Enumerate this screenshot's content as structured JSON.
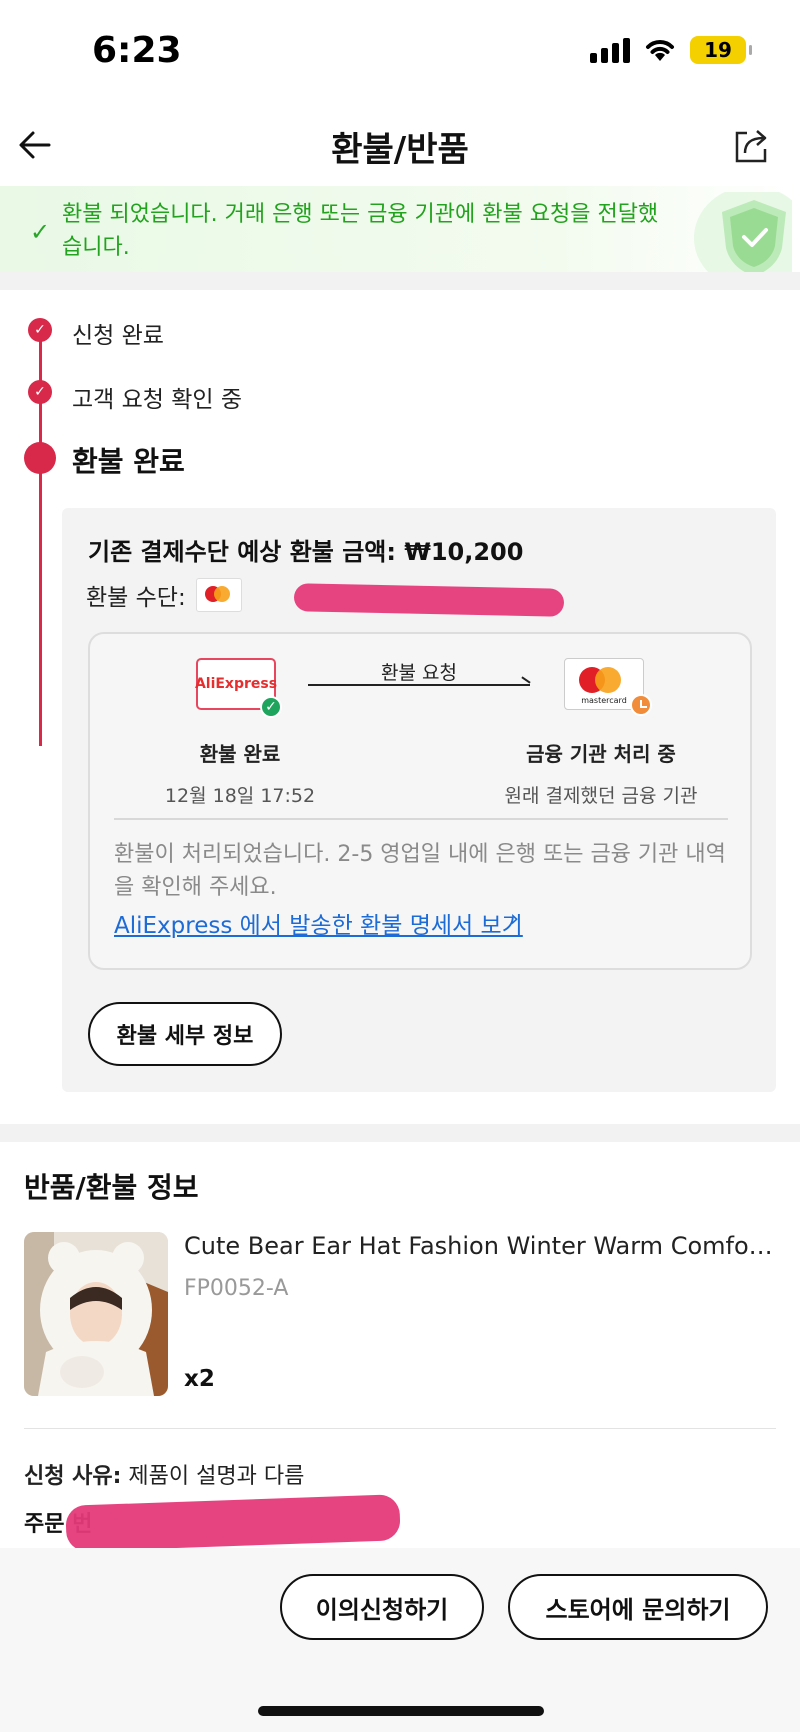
{
  "status_bar": {
    "time": "6:23",
    "battery": "19"
  },
  "nav": {
    "title": "환불/반품"
  },
  "banner": {
    "message": "환불 되었습니다. 거래 은행 또는 금융 기관에 환불 요청을 전달했습니다."
  },
  "timeline": {
    "steps": [
      {
        "label": "신청 완료"
      },
      {
        "label": "고객 요청 확인 중"
      },
      {
        "label": "환불 완료"
      }
    ]
  },
  "refund": {
    "amount_label": "기존 결제수단 예상 환불 금액:",
    "amount_value": "₩10,200",
    "method_label": "환불 수단:",
    "flow": {
      "from_logo": "AliExpress",
      "arrow_label": "환불 요청",
      "to_logo": "mastercard",
      "from_title": "환불 완료",
      "from_date": "12월 18일 17:52",
      "to_title": "금융 기관 처리 중",
      "to_sub": "원래 결제했던 금융 기관",
      "note": "환불이 처리되었습니다. 2-5 영업일 내에 은행 또는 금융 기관 내역을 확인해 주세요.",
      "link": "AliExpress 에서 발송한 환불 명세서 보기",
      "link_chevron": "›"
    },
    "details_button": "환불 세부 정보"
  },
  "return_info": {
    "title": "반품/환불 정보",
    "product": {
      "name": "Cute Bear Ear Hat Fashion Winter Warm Comfortable",
      "sku": "FP0052-A",
      "qty": "x2"
    },
    "reason_label": "신청 사유:",
    "reason_value": "제품이 설명과 다름",
    "order_label": "주문 번"
  },
  "bottom": {
    "appeal_button": "이의신청하기",
    "store_button": "스토어에 문의하기"
  },
  "colors": {
    "accent": "#d8294a",
    "success": "#22a31d",
    "link": "#1d6bd6"
  }
}
